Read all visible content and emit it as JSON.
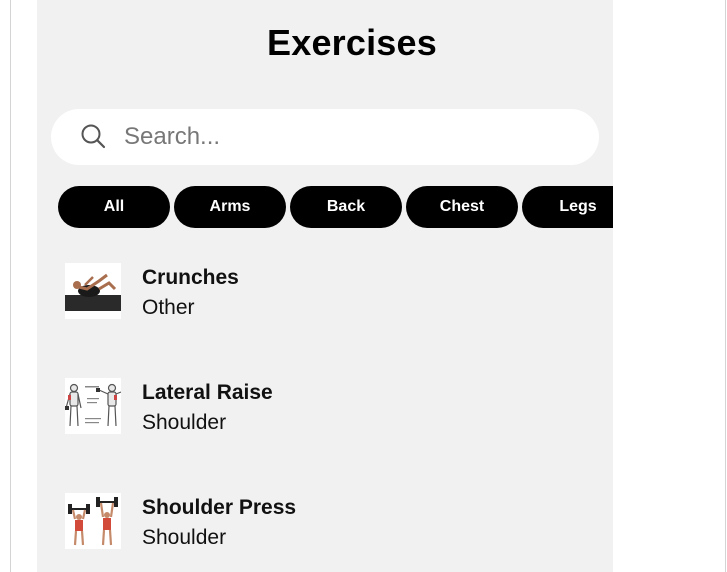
{
  "header": {
    "title": "Exercises"
  },
  "search": {
    "placeholder": "Search...",
    "value": "",
    "icon": "search-icon"
  },
  "filters": [
    {
      "label": "All"
    },
    {
      "label": "Arms"
    },
    {
      "label": "Back"
    },
    {
      "label": "Chest"
    },
    {
      "label": "Legs"
    }
  ],
  "exercises": [
    {
      "name": "Crunches",
      "category": "Other",
      "thumbnail": "crunches-illustration"
    },
    {
      "name": "Lateral Raise",
      "category": "Shoulder",
      "thumbnail": "lateral-raise-illustration"
    },
    {
      "name": "Shoulder Press",
      "category": "Shoulder",
      "thumbnail": "shoulder-press-illustration"
    }
  ],
  "colors": {
    "panel_background": "#f1f1f1",
    "chip_background": "#000000",
    "chip_text": "#ffffff",
    "search_background": "#ffffff"
  }
}
